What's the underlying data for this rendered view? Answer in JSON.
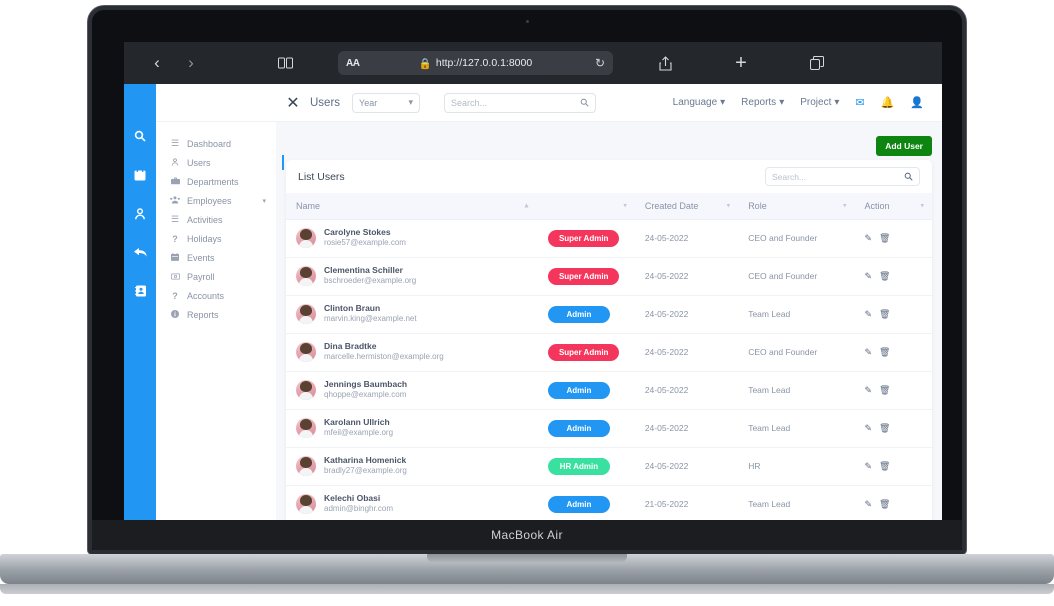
{
  "device": {
    "label": "MacBook Air"
  },
  "browser": {
    "back_icon": "chevron-left-icon",
    "forward_icon": "chevron-right-icon",
    "bookmarks_icon": "book-icon",
    "aa_label": "AA",
    "lock_icon": "lock-icon",
    "url": "http://127.0.0.1:8000",
    "reload_icon": "reload-icon",
    "share_icon": "share-icon",
    "new_tab_icon": "plus-icon",
    "tabs_icon": "tabs-icon"
  },
  "rail": {
    "items": [
      {
        "icon": "search-icon",
        "name": "rail-item-search"
      },
      {
        "icon": "calendar-icon",
        "name": "rail-item-calendar"
      },
      {
        "icon": "user-icon",
        "name": "rail-item-user"
      },
      {
        "icon": "reply-arrow-icon",
        "name": "rail-item-reply"
      },
      {
        "icon": "contact-book-icon",
        "name": "rail-item-contacts"
      }
    ]
  },
  "topbar": {
    "close_icon": "close-icon",
    "title": "Users",
    "period_select": {
      "value": "Year",
      "caret_icon": "chevron-down-icon"
    },
    "search": {
      "placeholder": "Search...",
      "value": "",
      "icon": "search-icon"
    },
    "links": [
      {
        "label": "Language",
        "caret_icon": "chevron-down-icon"
      },
      {
        "label": "Reports",
        "caret_icon": "chevron-down-icon"
      },
      {
        "label": "Project",
        "caret_icon": "chevron-down-icon"
      }
    ],
    "icons": [
      {
        "icon": "envelope-icon",
        "glyph": "✉",
        "color": "#2196f3"
      },
      {
        "icon": "bell-icon",
        "glyph": "🔔",
        "color": "#2196f3"
      },
      {
        "icon": "user-account-icon",
        "glyph": "👤",
        "color": "#c9862a"
      }
    ]
  },
  "sidebar": {
    "items": [
      {
        "label": "Dashboard",
        "icon": "list-icon",
        "glyph": "☰",
        "active": false,
        "caret": false
      },
      {
        "label": "Users",
        "icon": "user-icon",
        "glyph": "⍟",
        "active": true,
        "caret": false
      },
      {
        "label": "Departments",
        "icon": "briefcase-icon",
        "glyph": "▬",
        "active": false,
        "caret": false
      },
      {
        "label": "Employees",
        "icon": "users-group-icon",
        "glyph": "☰",
        "active": false,
        "caret": true
      },
      {
        "label": "Activities",
        "icon": "list-ul-icon",
        "glyph": "☰",
        "active": false,
        "caret": false
      },
      {
        "label": "Holidays",
        "icon": "question-icon",
        "glyph": "?",
        "active": false,
        "caret": false
      },
      {
        "label": "Events",
        "icon": "calendar-icon",
        "glyph": "▦",
        "active": false,
        "caret": false
      },
      {
        "label": "Payroll",
        "icon": "money-icon",
        "glyph": "▣",
        "active": false,
        "caret": false
      },
      {
        "label": "Accounts",
        "icon": "question-icon",
        "glyph": "?",
        "active": false,
        "caret": false
      },
      {
        "label": "Reports",
        "icon": "info-icon",
        "glyph": "ℹ",
        "active": false,
        "caret": false
      }
    ]
  },
  "main": {
    "add_user_label": "Add User",
    "card_title": "List Users",
    "card_search": {
      "placeholder": "Search...",
      "value": "",
      "icon": "search-icon"
    },
    "columns": [
      {
        "label": "Name",
        "sort": "asc"
      },
      {
        "label": "",
        "sort": "none"
      },
      {
        "label": "Created Date",
        "sort": "none"
      },
      {
        "label": "Role",
        "sort": "none"
      },
      {
        "label": "Action",
        "sort": "none"
      }
    ],
    "rows": [
      {
        "name": "Carolyne Stokes",
        "email": "rosie57@example.com",
        "badge": "Super Admin",
        "badge_type": "super",
        "created": "24-05-2022",
        "role": "CEO and Founder"
      },
      {
        "name": "Clementina Schiller",
        "email": "bschroeder@example.org",
        "badge": "Super Admin",
        "badge_type": "super",
        "created": "24-05-2022",
        "role": "CEO and Founder"
      },
      {
        "name": "Clinton Braun",
        "email": "marvin.king@example.net",
        "badge": "Admin",
        "badge_type": "admin",
        "created": "24-05-2022",
        "role": "Team Lead"
      },
      {
        "name": "Dina Bradtke",
        "email": "marcelle.hermiston@example.org",
        "badge": "Super Admin",
        "badge_type": "super",
        "created": "24-05-2022",
        "role": "CEO and Founder"
      },
      {
        "name": "Jennings Baumbach",
        "email": "qhoppe@example.com",
        "badge": "Admin",
        "badge_type": "admin",
        "created": "24-05-2022",
        "role": "Team Lead"
      },
      {
        "name": "Karolann Ullrich",
        "email": "mfeil@example.org",
        "badge": "Admin",
        "badge_type": "admin",
        "created": "24-05-2022",
        "role": "Team Lead"
      },
      {
        "name": "Katharina Homenick",
        "email": "bradly27@example.org",
        "badge": "HR Admin",
        "badge_type": "hr",
        "created": "24-05-2022",
        "role": "HR"
      },
      {
        "name": "Kelechi Obasi",
        "email": "admin@binghr.com",
        "badge": "Admin",
        "badge_type": "admin",
        "created": "21-05-2022",
        "role": "Team Lead"
      }
    ],
    "action_icons": {
      "edit": "pencil-icon",
      "delete": "trash-icon"
    }
  },
  "colors": {
    "accent_blue": "#2196f3",
    "badge_super": "#f5365c",
    "badge_admin": "#2196f3",
    "badge_hr": "#3ae0a0",
    "add_button": "#0f8511"
  }
}
